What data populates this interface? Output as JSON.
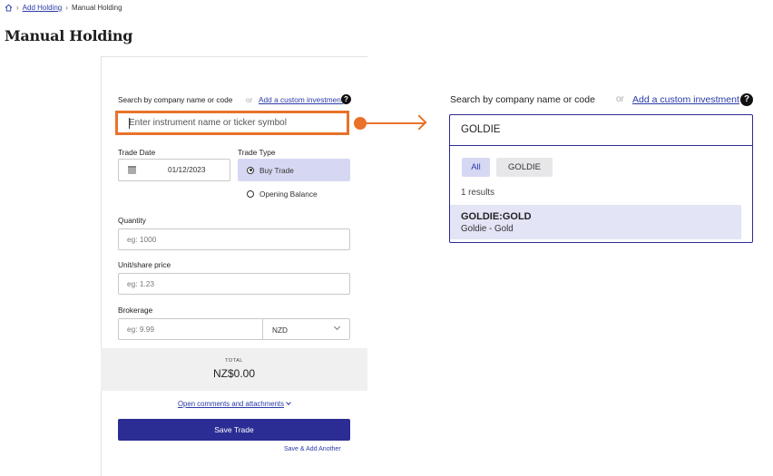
{
  "breadcrumb": {
    "home_icon": "home-icon",
    "items": [
      "Add Holding",
      "Manual Holding"
    ]
  },
  "page": {
    "title": "Manual Holding"
  },
  "form": {
    "search_label": "Search by company name or code",
    "or_text": "or",
    "custom_link": "Add a custom investment",
    "help_glyph": "?",
    "search_placeholder": "Enter instrument name or ticker symbol",
    "trade_date_label": "Trade Date",
    "trade_date_value": "01/12/2023",
    "trade_type_label": "Trade Type",
    "buy_trade": "Buy Trade",
    "opening_balance": "Opening Balance",
    "quantity_label": "Quantity",
    "quantity_placeholder": "eg: 1000",
    "unit_price_label": "Unit/share price",
    "unit_price_placeholder": "eg: 1.23",
    "brokerage_label": "Brokerage",
    "brokerage_placeholder": "eg: 9.99",
    "currency": "NZD",
    "total_label": "TOTAL",
    "total_value": "NZ$0.00",
    "open_comments": "Open comments and attachments",
    "save_trade": "Save Trade",
    "save_add_another": "Save & Add Another"
  },
  "zoom": {
    "search_label": "Search by company name or code",
    "or_text": "or",
    "custom_link": "Add a custom investment",
    "help_glyph": "?",
    "input_value": "GOLDIE",
    "chips": [
      "All",
      "GOLDIE"
    ],
    "result_count": "1 results",
    "result": {
      "code": "GOLDIE:GOLD",
      "name": "Goldie - Gold"
    }
  },
  "colors": {
    "highlight": "#e8722a",
    "primary": "#2b2c94",
    "link": "#2a3aa8",
    "selected_bg": "#d6d8f3"
  }
}
